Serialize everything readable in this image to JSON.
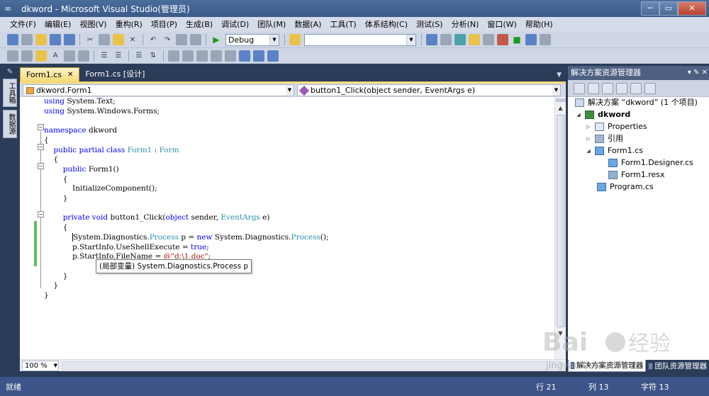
{
  "window": {
    "title": "dkword - Microsoft Visual Studio(管理员)",
    "min_label": "─",
    "max_label": "▭",
    "close_label": "✕"
  },
  "menu": [
    "文件(F)",
    "编辑(E)",
    "视图(V)",
    "重构(R)",
    "项目(P)",
    "生成(B)",
    "调试(D)",
    "团队(M)",
    "数据(A)",
    "工具(T)",
    "体系结构(C)",
    "测试(S)",
    "分析(N)",
    "窗口(W)",
    "帮助(H)"
  ],
  "toolbar": {
    "config_value": "Debug",
    "find_value": ""
  },
  "left_strip": {
    "toolbox_label": "工具箱",
    "datasource_label": "数据源"
  },
  "doc_tabs": [
    {
      "label": "Form1.cs",
      "active": true
    },
    {
      "label": "Form1.cs [设计]",
      "active": false
    }
  ],
  "navbar": {
    "class_value": "dkword.Form1",
    "member_value": "button1_Click(object sender, EventArgs e)"
  },
  "code": {
    "tooltip": "(局部变量) System.Diagnostics.Process p"
  },
  "editor_bottom": {
    "zoom": "100 %"
  },
  "solution_explorer": {
    "title": "解决方案资源管理器",
    "solution": "解决方案 “dkword” (1 个项目)",
    "project": "dkword",
    "items": {
      "properties": "Properties",
      "references": "引用",
      "form1": "Form1.cs",
      "form1_designer": "Form1.Designer.cs",
      "form1_resx": "Form1.resx",
      "program": "Program.cs"
    },
    "tabs": [
      "解决方案资源管理器",
      "团队资源管理器"
    ]
  },
  "status": {
    "ready": "就绪",
    "line": "行 21",
    "col": "列 13",
    "char": "字符 13"
  },
  "watermark": "jingyan.baidu.com"
}
